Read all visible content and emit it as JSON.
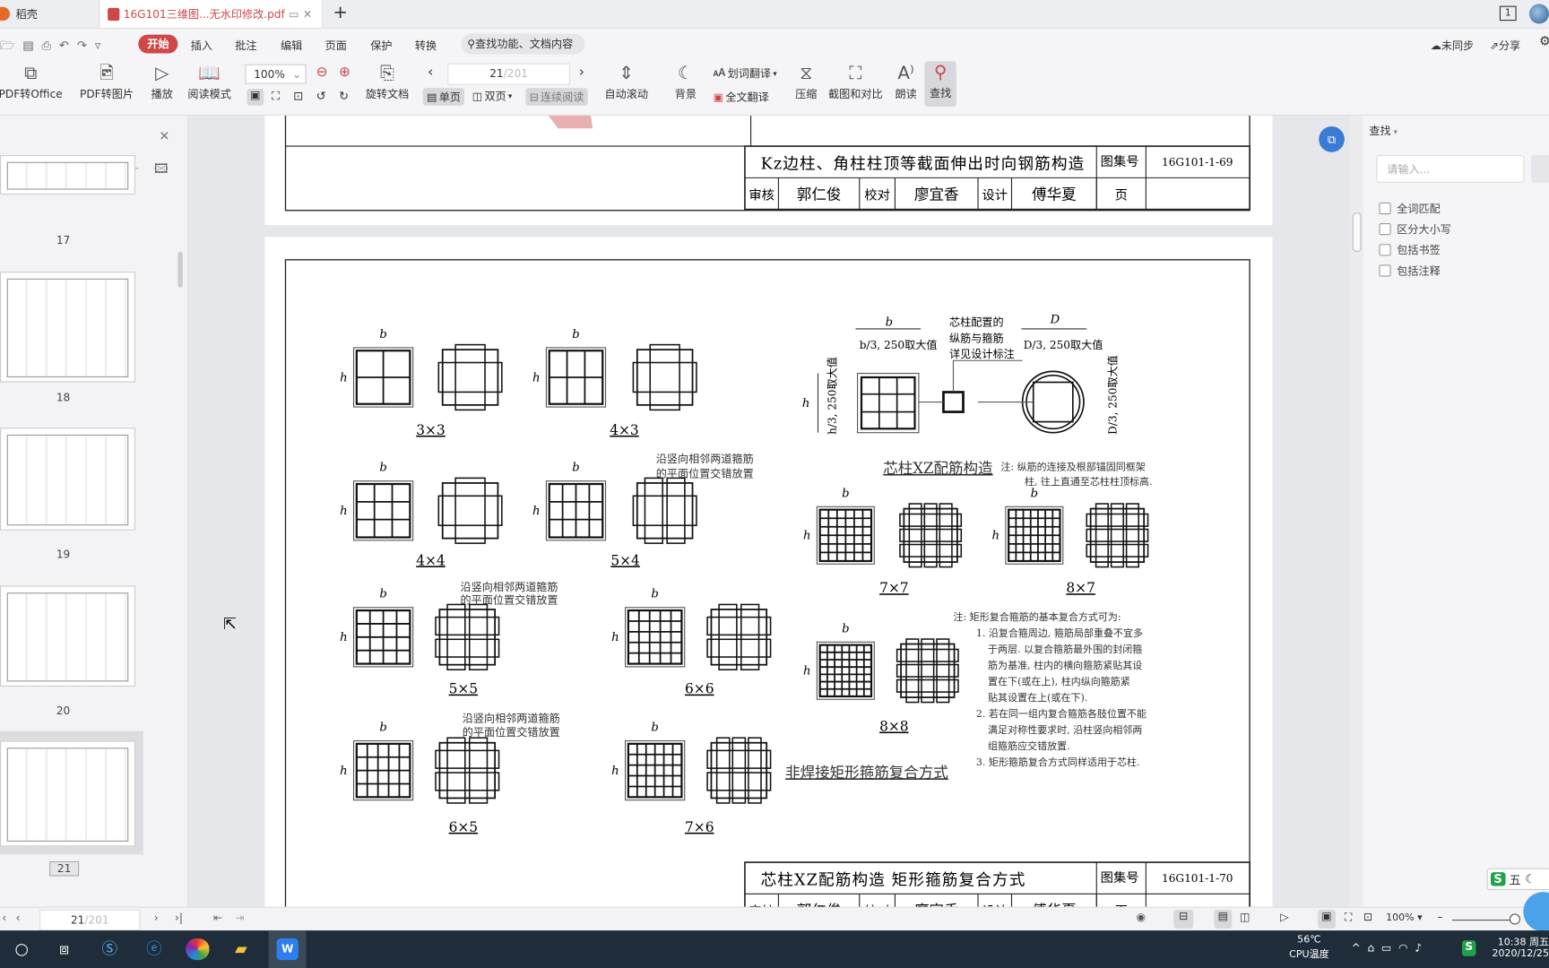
{
  "tabs": [
    {
      "label": "稻壳",
      "icon": "docer-icon"
    },
    {
      "label": "16G101三维图...无水印修改.pdf",
      "icon": "pdf-icon"
    }
  ],
  "tab_new": "+",
  "window": {
    "page_badge": "1"
  },
  "menu": {
    "items": [
      "开始",
      "插入",
      "批注",
      "编辑",
      "页面",
      "保护",
      "转换"
    ],
    "search_placeholder": "查找功能、文档内容",
    "sync": "未同步",
    "share": "分享"
  },
  "toolbar": {
    "pdf_office": "PDF转Office",
    "pdf_image": "PDF转图片",
    "play": "播放",
    "read_mode": "阅读模式",
    "zoom": "100%",
    "rotate": "旋转文档",
    "page_current": "21",
    "page_total": "/201",
    "single": "单页",
    "double": "双页",
    "continuous": "连续阅读",
    "auto_scroll": "自动滚动",
    "background": "背景",
    "word_translate": "划词翻译",
    "full_translate": "全文翻译",
    "compress": "压缩",
    "screenshot": "截图和对比",
    "read_aloud": "朗读",
    "find": "查找"
  },
  "thumbnails": [
    {
      "page": "17"
    },
    {
      "page": "18"
    },
    {
      "page": "19"
    },
    {
      "page": "20"
    },
    {
      "page": "21",
      "selected": true
    }
  ],
  "page1": {
    "title": "Kz边柱、角柱柱顶等截面伸出时向钢筋构造",
    "atlas_label": "图集号",
    "atlas_no": "16G101-1-69",
    "row2": [
      "审核",
      "郭仁俊",
      "校对",
      "廖宜香",
      "设计",
      "傅华夏",
      "页",
      ""
    ]
  },
  "page2": {
    "title": "芯柱XZ配筋构造 矩形箍筋复合方式",
    "atlas_label": "图集号",
    "atlas_no": "16G101-1-70",
    "row2": [
      "审核",
      "郭仁俊",
      "校对",
      "廖宜香",
      "设计",
      "傅华夏",
      "页",
      ""
    ],
    "diagrams": [
      "3×3",
      "4×3",
      "4×4",
      "5×4",
      "5×5",
      "6×6",
      "6×5",
      "7×6",
      "7×7",
      "8×7",
      "8×8"
    ],
    "dim_b": "b",
    "dim_h": "h",
    "dim_D": "D",
    "stagger_note": [
      "沿竖向相邻两道箍筋",
      "的平面位置交错放置"
    ],
    "core_dim_b": "b/3, 250取大值",
    "core_dim_h": "h/3, 250取大值",
    "core_dim_D": "D/3, 250取大值",
    "core_dim_D2": "D/3, 250取大值",
    "core_callout": [
      "芯柱配置的",
      "纵筋与箍筋",
      "详见设计标注"
    ],
    "core_title": "芯柱XZ配筋构造",
    "core_note": [
      "注: 纵筋的连接及根部锚固同框架",
      "柱, 往上直通至芯柱柱顶标高."
    ],
    "rect_title": "非焊接矩形箍筋复合方式",
    "rect_note": [
      "注: 矩形复合箍筋的基本复合方式可为:",
      "1. 沿复合箍周边, 箍筋局部重叠不宜多",
      "于两层. 以复合箍筋最外围的封闭箍",
      "筋为基准, 柱内的横向箍筋紧贴其设",
      "置在下(或在上), 柱内纵向箍筋紧",
      "贴其设置在上(或在下).",
      "2. 若在同一组内复合箍筋各肢位置不能",
      "满足对称性要求时, 沿柱竖向相邻两",
      "组箍筋应交错放置.",
      "3. 矩形箍筋复合方式同样适用于芯柱."
    ]
  },
  "find_panel": {
    "title": "查找",
    "placeholder": "请输入...",
    "options": [
      "全词匹配",
      "区分大小写",
      "包括书签",
      "包括注释"
    ]
  },
  "status": {
    "page_current": "21",
    "page_total": "/201",
    "zoom": "100%"
  },
  "ime": {
    "label": "五"
  },
  "taskbar": {
    "temp": "56℃",
    "temp_label": "CPU温度",
    "time": "10:38 周五",
    "date": "2020/12/25"
  },
  "colors": {
    "accent": "#d0474a",
    "find_blue": "#3a7bd5",
    "taskbar": "#1f2d3a"
  }
}
